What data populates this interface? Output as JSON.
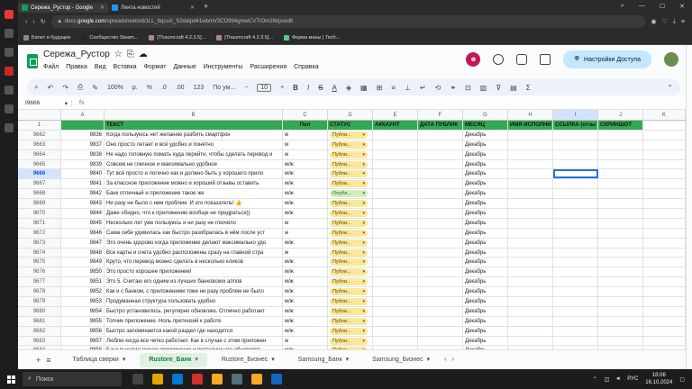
{
  "browser": {
    "tabs": [
      {
        "title": "Сережа_Рустор - Google",
        "active": true
      },
      {
        "title": "Лента новостей",
        "active": false
      }
    ],
    "url_prefix": "docs.",
    "url_domain": "google.com",
    "url_rest": "/spreadsheets/d/1LL_bqcuX_S2datpd41wbmV3CO994gmwCVTIOm28ojs/edit",
    "bookmarks": [
      "Билет в будущее",
      "Сообщество Steam...",
      "[Thaumcraft 4.2.3.5]...",
      "[Thaumcraft 4.2.3.5]...",
      "Ферма маны | Tech..."
    ]
  },
  "doc": {
    "title": "Сережа_Рустор",
    "menus": [
      "Файл",
      "Правка",
      "Вид",
      "Вставка",
      "Формат",
      "Данные",
      "Инструменты",
      "Расширения",
      "Справка"
    ],
    "share_label": "Настройки Доступа"
  },
  "toolbar": {
    "zoom": "100%",
    "currency": "р.",
    "percent": "%",
    "dec_down": ".0",
    "dec_up": ".00",
    "num_format": "123",
    "font": "По ум...",
    "font_size": "10"
  },
  "formula": {
    "cell": "I9666",
    "fx": "fx"
  },
  "columns": [
    "",
    "A",
    "B",
    "C",
    "D",
    "E",
    "F",
    "G",
    "H",
    "I",
    "J",
    "K"
  ],
  "header_row": {
    "rn": "1",
    "a": "",
    "b": "ТЕКСТ",
    "c": "Пол",
    "d": "СТАТУС",
    "e": "АККАУНТ",
    "f": "ДАТА ПУБЛИК",
    "g": "МЕСЯЦ",
    "h": "ИМЯ ИСПОЛНИ",
    "i": "ССЫЛКА (отзы",
    "j": "СКРИНШОТ",
    "k": ""
  },
  "rows": [
    {
      "rn": "9662",
      "a": "9836",
      "b": "Когда пользуюсь нет желанию разбить смартфон",
      "c": "ж",
      "d": "Публи...",
      "g": "Декабрь"
    },
    {
      "rn": "9663",
      "a": "9837",
      "b": "Оно просто летает и всё удобно и понятно",
      "c": "м",
      "d": "Публи...",
      "g": "Декабрь"
    },
    {
      "rn": "9664",
      "a": "9838",
      "b": "Не надо головную помать куда перейти, чтобы сделать перевод и",
      "c": "ж",
      "d": "Публи...",
      "g": "Декабрь"
    },
    {
      "rn": "9665",
      "a": "9839",
      "b": "Совсем не глючное и максимально удобное",
      "c": "м/ж",
      "d": "Публи...",
      "g": "Декабрь"
    },
    {
      "rn": "9666",
      "a": "9840",
      "b": "Тут всё просто и логично как и должно быть у хорошего прило",
      "c": "м/ж",
      "d": "Публи...",
      "g": "Декабрь"
    },
    {
      "rn": "9667",
      "a": "9841",
      "b": "За классное приложение можно и хороший отзывы оставить",
      "c": "м/ж",
      "d": "Публи...",
      "g": "Декабрь"
    },
    {
      "rn": "9668",
      "a": "9842",
      "b": "Банк отличный и приложение такое же",
      "c": "м/ж",
      "d": "Опубл...",
      "g": "Декабрь"
    },
    {
      "rn": "9669",
      "a": "9843",
      "b": "Ни разу не было с ним проблем. И это показатель! 👍",
      "c": "м/ж",
      "d": "Публи...",
      "g": "Декабрь"
    },
    {
      "rn": "9670",
      "a": "9844",
      "b": "Даже обидно, что к приложению вообще не придраться))",
      "c": "м/ж",
      "d": "Публи...",
      "g": "Декабрь"
    },
    {
      "rn": "9671",
      "a": "9845",
      "b": "Несколько лет уже пользуюсь и ни разу не глючило",
      "c": "м",
      "d": "Публи...",
      "g": "Декабрь"
    },
    {
      "rn": "9672",
      "a": "9846",
      "b": "Сама себе удивилась как быстро разобралась в нём после уст",
      "c": "ж",
      "d": "Публи...",
      "g": "Декабрь"
    },
    {
      "rn": "9673",
      "a": "9847",
      "b": "Это очень здорово когда приложение делают максимально удо",
      "c": "м/ж",
      "d": "Публи...",
      "g": "Декабрь"
    },
    {
      "rn": "9674",
      "a": "9848",
      "b": "Все карты и счета удобно расположены сразу на главной стра",
      "c": "ж",
      "d": "Публи...",
      "g": "Декабрь"
    },
    {
      "rn": "9675",
      "a": "9849",
      "b": "Круто, что перевод можно сделать в несколько кликов",
      "c": "м/ж",
      "d": "Публи...",
      "g": "Декабрь"
    },
    {
      "rn": "9676",
      "a": "9850",
      "b": "Это просто хорошее приложение!",
      "c": "м/ж",
      "d": "Публи...",
      "g": "Декабрь"
    },
    {
      "rn": "9677",
      "a": "9851",
      "b": "Это 5. Считаю его одним из лучших банковских аппов",
      "c": "м/ж",
      "d": "Публи...",
      "g": "Декабрь"
    },
    {
      "rn": "9678",
      "a": "9852",
      "b": "Как и с банком, с приложением тоже ни разу проблем не было",
      "c": "м/ж",
      "d": "Публи...",
      "g": "Декабрь"
    },
    {
      "rn": "9679",
      "a": "9853",
      "b": "Продуманная структура пользовать удобно",
      "c": "м/ж",
      "d": "Публи...",
      "g": "Декабрь"
    },
    {
      "rn": "9680",
      "a": "9854",
      "b": "Быстро установилось, регулярно обновляю. Отлично работает",
      "c": "м/ж",
      "d": "Публи...",
      "g": "Декабрь"
    },
    {
      "rn": "9681",
      "a": "9855",
      "b": "Топчик приложение. Ноль претензий к работе",
      "c": "м/ж",
      "d": "Публи...",
      "g": "Декабрь"
    },
    {
      "rn": "9682",
      "a": "9856",
      "b": "Быстро запоминается какой раздел где находится",
      "c": "м/ж",
      "d": "Публи...",
      "g": "Декабрь"
    },
    {
      "rn": "9683",
      "a": "9857",
      "b": "Люблю когда все четко работает. Как в случае с этим приложен",
      "c": "ж",
      "d": "Публи...",
      "g": "Декабрь"
    },
    {
      "rn": "9684",
      "a": "9858",
      "b": "Банк выкатил годное приложение и постоянно его обновляет",
      "c": "м/ж",
      "d": "Публи...",
      "g": "Декабрь"
    }
  ],
  "sheet_tabs": [
    "Таблица сверки",
    "Rustore_Банк",
    "Rustore_Бизнес",
    "Samsung_Банк",
    "Samsung_Бизнес"
  ],
  "active_sheet": "Rustore_Банк",
  "taskbar": {
    "search": "Поиск",
    "lang": "РУС",
    "time": "18:06",
    "date": "16.10.2024"
  }
}
